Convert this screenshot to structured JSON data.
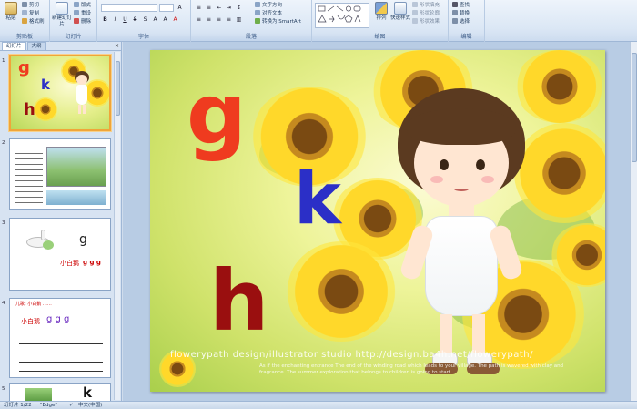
{
  "ribbon": {
    "clipboard": {
      "group_label": "剪贴板",
      "paste_label": "粘贴",
      "cut_label": "剪切",
      "copy_label": "复制",
      "format_painter_label": "格式刷"
    },
    "slides": {
      "group_label": "幻灯片",
      "new_slide_label": "新建幻灯片",
      "layout_label": "版式",
      "reset_label": "重设",
      "delete_label": "删除"
    },
    "font": {
      "group_label": "字体"
    },
    "paragraph": {
      "group_label": "段落",
      "text_direction_label": "文字方向",
      "align_text_label": "对齐文本",
      "smartart_label": "转换为 SmartArt"
    },
    "drawing": {
      "group_label": "绘图",
      "arrange_label": "排列",
      "quick_styles_label": "快速样式",
      "shape_fill_label": "形状填充",
      "shape_outline_label": "形状轮廓",
      "shape_effects_label": "形状效果"
    },
    "editing": {
      "group_label": "编辑",
      "find_label": "查找",
      "replace_label": "替换",
      "select_label": "选择"
    }
  },
  "left_pane": {
    "tabs": [
      "幻灯片",
      "大纲"
    ],
    "close_glyph": "×",
    "thumbnails": [
      {
        "number": "1",
        "letters": [
          "g",
          "k",
          "h"
        ]
      },
      {
        "number": "2"
      },
      {
        "number": "3",
        "letter": "g",
        "text": "小白鹅",
        "extra": "g g g"
      },
      {
        "number": "4",
        "text": "小白鹅",
        "letters": "g g g",
        "note": "儿歌: 小白鹅 ……"
      },
      {
        "number": "5",
        "letter": "k"
      }
    ]
  },
  "slide": {
    "letters": {
      "g": "g",
      "k": "k",
      "h": "h"
    },
    "credit": "flowerypath design/illustrator studio  http://design.ba4h.net/flowerypath/",
    "caption": "As if the enchanting entrance The end of the winding road which leads to your village. The path is wavered with clay and fragrance. The summer exploration that belongs to children is going to start."
  },
  "statusbar": {
    "slide_info": "幻灯片 1/22",
    "theme": "\"Edge\"",
    "language": "中文(中国)"
  },
  "colors": {
    "letter_g": "#ef3b1f",
    "letter_k": "#2b2fc7",
    "letter_h": "#9a0f0f",
    "selection": "#f0a53a"
  }
}
